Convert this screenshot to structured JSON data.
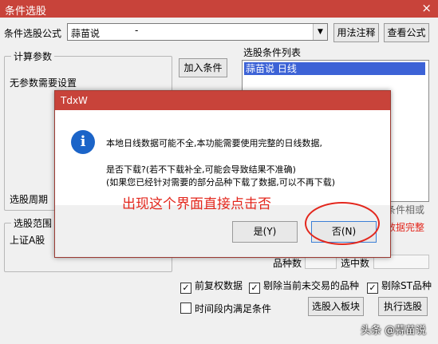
{
  "window": {
    "title": "条件选股",
    "close": "×"
  },
  "formula": {
    "label": "条件选股公式",
    "value": "蒜苗说",
    "suffix": "-",
    "arrow": "▼"
  },
  "buttons": {
    "usage_note": "用法注释",
    "view_formula": "查看公式",
    "add_condition": "加入条件",
    "to_sector": "选股入板块",
    "run": "执行选股"
  },
  "params_group": {
    "caption": "计算参数",
    "text": "无参数需要设置"
  },
  "period_label": "选股周期",
  "scope_group": {
    "caption": "选股范围",
    "item": "上证A股"
  },
  "condition_list": {
    "caption": "选股条件列表",
    "items": [
      "蒜苗说  日线"
    ]
  },
  "right_partial": {
    "line1": "条件相或",
    "line2": "数据完整"
  },
  "counts": {
    "count_label": "品种数",
    "selected_label": "选中数"
  },
  "options": {
    "adjust": "前复权数据",
    "exclude_suspended": "剔除当前未交易的品种",
    "exclude_st": "剔除ST品种",
    "period_satisfy": "时间段内满足条件"
  },
  "dialog": {
    "title": "TdxW",
    "line1": "本地日线数据可能不全,本功能需要使用完整的日线数据,",
    "line2": "是否下载?(若不下载补全,可能会导致结果不准确)",
    "line3": "(如果您已经针对需要的部分品种下载了数据,可以不再下载)",
    "yes": "是(Y)",
    "no": "否(N)",
    "icon": "info-icon"
  },
  "annotation": "出现这个界面直接点击否",
  "watermark": "头条 @蒜苗说",
  "colors": {
    "title_bar": "#c8433a",
    "annotation": "#e3271d",
    "selection": "#3c62d6",
    "info_icon": "#1b64c8"
  }
}
